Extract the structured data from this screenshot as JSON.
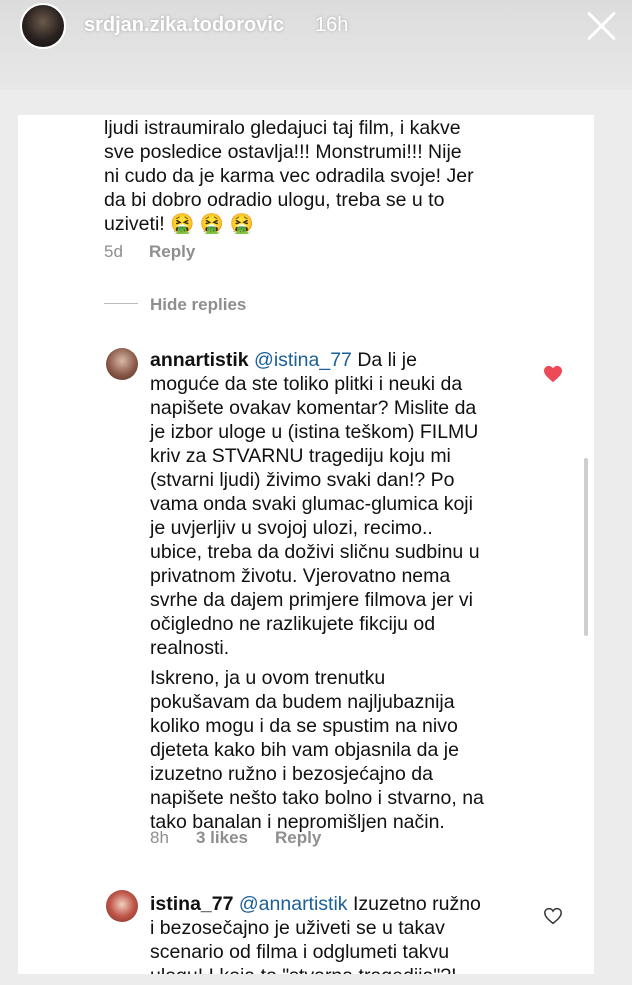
{
  "story": {
    "username": "srdjan.zika.todorovic",
    "time": "16h"
  },
  "comment1": {
    "lines": [
      "ljudi istraumiralo gledajuci taj film, i kakve",
      "sve posledice ostavlja!!! Monstrumi!!! Nije",
      "ni cudo da je karma vec odradila svoje! Jer",
      "da bi dobro odradio ulogu, treba se u to",
      "uziveti! 🤮 🤮 🤮"
    ],
    "time": "5d",
    "reply": "Reply"
  },
  "hide_replies": "Hide replies",
  "reply1": {
    "username": "annartistik",
    "mention": "@istina_77",
    "first_line_rest": " Da li je",
    "lines": [
      "moguće da ste toliko plitki i neuki da",
      "napišete ovakav komentar? Mislite da",
      "je izbor uloge u (istina teškom) FILMU",
      "kriv za STVARNU tragediju koju mi",
      "(stvarni ljudi) živimo svaki dan!? Po",
      "vama onda svaki glumac-glumica koji",
      "je uvjerljiv u svojoj ulozi, recimo..",
      "ubice, treba da doživi sličnu sudbinu u",
      "privatnom životu. Vjerovatno nema",
      "svrhe da dajem primjere filmova jer vi",
      "očigledno ne razlikujete fikciju od",
      "realnosti.",
      "Iskreno, ja u ovom trenutku",
      "pokušavam da budem najljubaznija",
      "koliko mogu i da se spustim na nivo",
      "djeteta kako bih vam objasnila da je",
      "izuzetno ružno i bezosjećajno da",
      "napišete nešto tako bolno i stvarno, na",
      "tako banalan i nepromišljen način."
    ],
    "time": "8h",
    "likes": "3 likes",
    "reply": "Reply",
    "liked": true,
    "heart_color": "#ed4956"
  },
  "reply2": {
    "username": "istina_77",
    "mention": "@annartistik",
    "first_line_rest": " Izuzetno ružno",
    "lines": [
      "i bezosečajno je uživeti se u takav",
      "scenario od filma i odglumeti takvu",
      "ulogu! I koja to \"stvarna tragedija\"?!"
    ],
    "liked": false
  }
}
